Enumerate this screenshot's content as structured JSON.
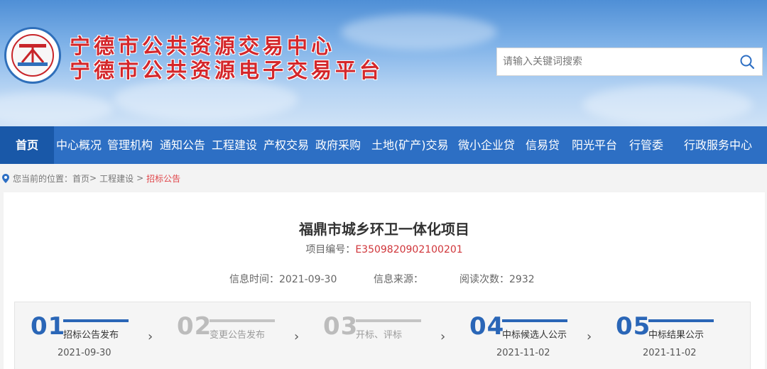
{
  "header": {
    "title_line1": "宁德市公共资源交易中心",
    "title_line2": "宁德市公共资源电子交易平台",
    "logo_icon": "ningde-trading-center-logo"
  },
  "search": {
    "placeholder": "请输入关键词搜索",
    "value": "",
    "icon": "search-icon"
  },
  "nav": {
    "items": [
      {
        "label": "首页",
        "active": true
      },
      {
        "label": "中心概况"
      },
      {
        "label": "管理机构"
      },
      {
        "label": "通知公告"
      },
      {
        "label": "工程建设"
      },
      {
        "label": "产权交易"
      },
      {
        "label": "政府采购"
      },
      {
        "label": "土地(矿产)交易"
      },
      {
        "label": "微小企业贷"
      },
      {
        "label": "信易贷"
      },
      {
        "label": "阳光平台"
      },
      {
        "label": "行管委"
      },
      {
        "label": "行政服务中心"
      }
    ]
  },
  "breadcrumb": {
    "prefix": "您当前的位置：",
    "items": [
      "首页",
      "工程建设",
      "招标公告"
    ],
    "separator": ">"
  },
  "project": {
    "title": "福鼎市城乡环卫一体化项目",
    "code_label": "项目编号：",
    "code": "E3509820902100201",
    "info_time_label": "信息时间：",
    "info_time": "2021-09-30",
    "info_source_label": "信息来源：",
    "info_source": "",
    "views_label": "阅读次数：",
    "views": "2932"
  },
  "steps": [
    {
      "num": "01",
      "label": "招标公告发布",
      "date": "2021-09-30",
      "done": true
    },
    {
      "num": "02",
      "label": "变更公告发布",
      "date": "",
      "done": false
    },
    {
      "num": "03",
      "label": "开标、评标",
      "date": "",
      "done": false
    },
    {
      "num": "04",
      "label": "中标候选人公示",
      "date": "2021-11-02",
      "done": true
    },
    {
      "num": "05",
      "label": "中标结果公示",
      "date": "2021-11-02",
      "done": true
    }
  ],
  "colors": {
    "brand_red": "#d4272b",
    "nav_blue": "#2d6fc4",
    "nav_active": "#1958a8",
    "step_active": "#2a66b7",
    "step_inactive": "#bcbcbc"
  }
}
